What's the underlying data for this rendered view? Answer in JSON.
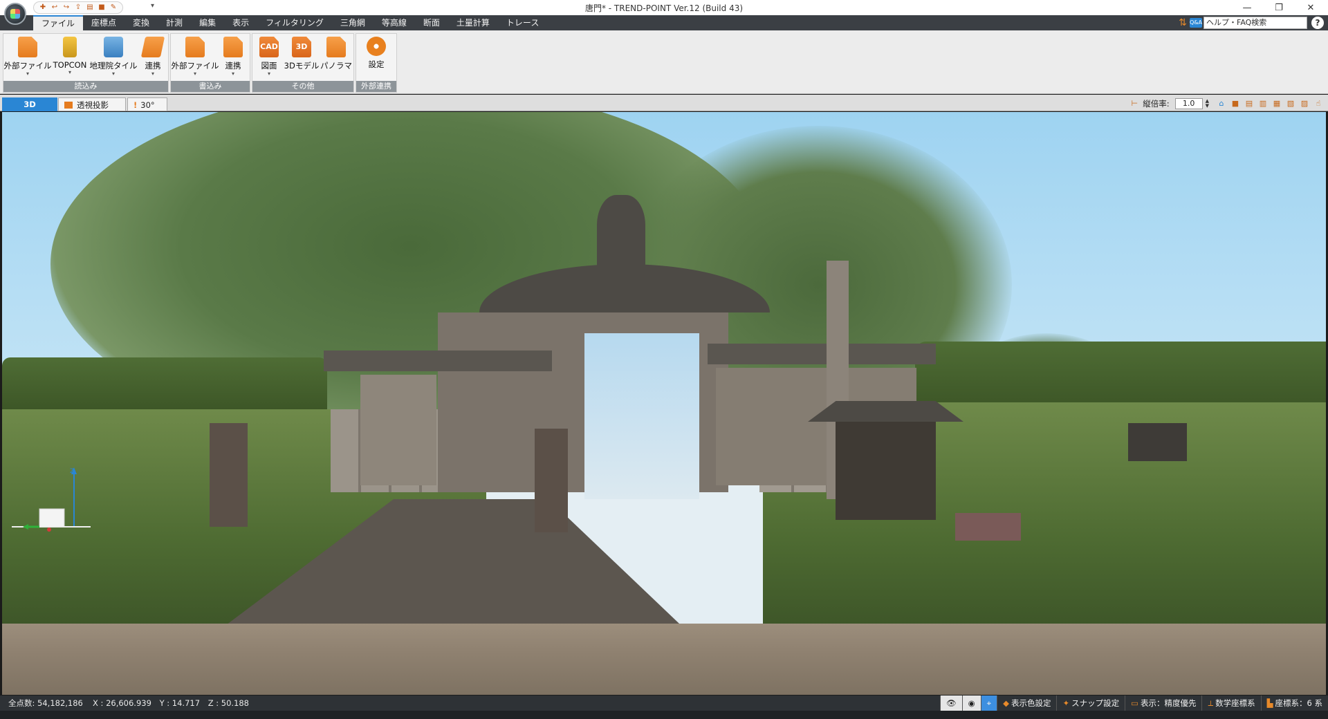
{
  "window": {
    "title": "唐門* - TREND-POINT Ver.12 (Build 43)",
    "minimize_glyph": "—",
    "maximize_glyph": "❐",
    "close_glyph": "✕"
  },
  "qat": {
    "icons": [
      "new-icon",
      "open-icon",
      "save-icon",
      "export-icon",
      "pdf-icon",
      "3d-icon",
      "settings-icon"
    ],
    "more_glyph": "▾"
  },
  "tabs": [
    {
      "label": "ファイル",
      "active": true
    },
    {
      "label": "座標点"
    },
    {
      "label": "変換"
    },
    {
      "label": "計測"
    },
    {
      "label": "編集"
    },
    {
      "label": "表示"
    },
    {
      "label": "フィルタリング"
    },
    {
      "label": "三角網"
    },
    {
      "label": "等高線"
    },
    {
      "label": "断面"
    },
    {
      "label": "土量計算"
    },
    {
      "label": "トレース"
    }
  ],
  "help": {
    "qa_badge": "Q&A",
    "search_label": "ヘルプ・FAQ検索",
    "help_glyph": "?"
  },
  "ribbon": {
    "groups": [
      {
        "label": "読込み",
        "buttons": [
          "外部ファイル",
          "TOPCON",
          "地理院タイル",
          "連携"
        ]
      },
      {
        "label": "書込み",
        "buttons": [
          "外部ファイル",
          "連携"
        ]
      },
      {
        "label": "その他",
        "buttons": [
          "図面",
          "3Dモデル",
          "パノラマ"
        ]
      },
      {
        "label": "外部連携",
        "buttons": [
          "設定"
        ]
      }
    ],
    "icon_text": {
      "cad": "CAD",
      "model": "3D"
    }
  },
  "viewbar": {
    "mode": "3D",
    "projection": "透視投影",
    "fov": "30°",
    "scale_label": "縦倍率:",
    "scale_value": "1.0"
  },
  "status": {
    "point_count": "全点数: 54,182,186",
    "x": "X : 26,606.939",
    "y": "Y : 14.717",
    "z": "Z : 50.188",
    "buttons": [
      "表示色設定",
      "スナップ設定",
      "表示：精度優先",
      "数学座標系",
      "座標系：6 系"
    ]
  },
  "colors": {
    "accent": "#2a86d4",
    "ribbon_orange": "#e57b1e",
    "tabrow": "#3b3f44",
    "status": "#2e3236"
  }
}
